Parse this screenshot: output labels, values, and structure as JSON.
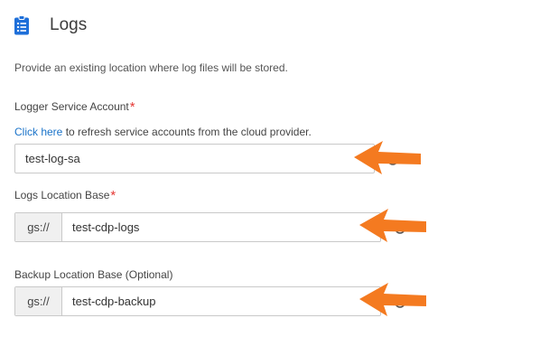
{
  "section": {
    "title": "Logs",
    "icon": "clipboard-list-icon",
    "description": "Provide an existing location where log files will be stored."
  },
  "logger_service_account": {
    "label": "Logger Service Account",
    "required_marker": "*",
    "refresh_link": "Click here",
    "refresh_text": " to refresh service accounts from the cloud provider.",
    "value": "test-log-sa"
  },
  "logs_location_base": {
    "label": "Logs Location Base",
    "required_marker": "*",
    "prefix": "gs://",
    "value": "test-cdp-logs"
  },
  "backup_location_base": {
    "label": "Backup Location Base (Optional)",
    "prefix": "gs://",
    "value": "test-cdp-backup"
  },
  "colors": {
    "accent": "#1a73c9",
    "required": "#e53935",
    "annotation_arrow": "#f47a20"
  },
  "annotations": [
    "arrow-icon",
    "arrow-icon",
    "arrow-icon"
  ]
}
